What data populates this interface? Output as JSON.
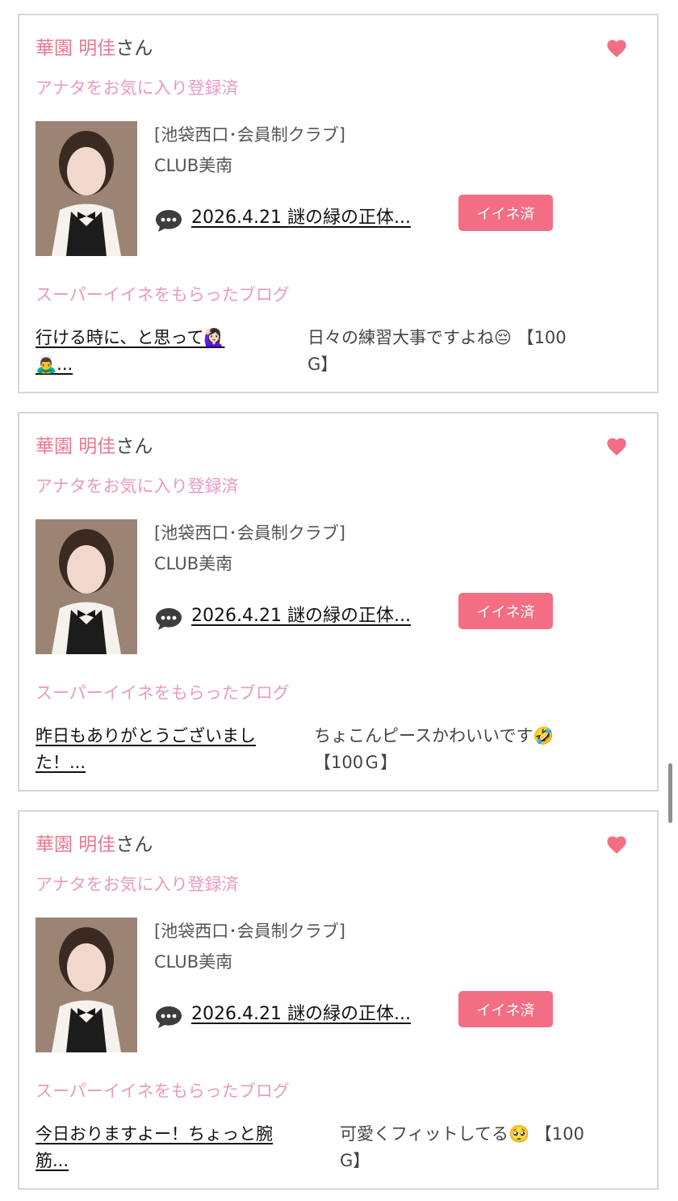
{
  "colors": {
    "accent": "#f36e83",
    "name_pink": "#e8798f",
    "label_pink": "#e89ac4",
    "border": "#d6d6d6"
  },
  "cards": [
    {
      "name": "華園 明佳",
      "suffix": "さん",
      "favorite_status": "アナタをお気に入り登録済",
      "shop_category": "[池袋西口･会員制クラブ]",
      "shop_name": "CLUB美南",
      "blog_link": "2026.4.21 謎の緑の正体...",
      "iine_button": "イイネ済",
      "super_iine_title": "スーパーイイネをもらったブログ",
      "blog_title_line1": "行ける時に、と思って🙋🏻‍♀️",
      "blog_title_line2": "🙇‍♂️...",
      "comment_line1": "日々の練習大事ですよね😔 【100",
      "comment_line2": "G】"
    },
    {
      "name": "華園 明佳",
      "suffix": "さん",
      "favorite_status": "アナタをお気に入り登録済",
      "shop_category": "[池袋西口･会員制クラブ]",
      "shop_name": "CLUB美南",
      "blog_link": "2026.4.21 謎の緑の正体...",
      "iine_button": "イイネ済",
      "super_iine_title": "スーパーイイネをもらったブログ",
      "blog_title_line1": "昨日もありがとうございまし",
      "blog_title_line2": "た！...",
      "comment_line1": "ちょこんピースかわいいです🤣",
      "comment_line2": "【100Ｇ】"
    },
    {
      "name": "華園 明佳",
      "suffix": "さん",
      "favorite_status": "アナタをお気に入り登録済",
      "shop_category": "[池袋西口･会員制クラブ]",
      "shop_name": "CLUB美南",
      "blog_link": "2026.4.21 謎の緑の正体...",
      "iine_button": "イイネ済",
      "super_iine_title": "スーパーイイネをもらったブログ",
      "blog_title_line1": "今日おりますよー！ちょっと腕",
      "blog_title_line2": "筋...",
      "comment_line1": "可愛くフィットしてる🥺 【100",
      "comment_line2": "G】"
    }
  ],
  "icons": {
    "favorite": "heart-icon",
    "comment": "speech-bubble-icon"
  }
}
